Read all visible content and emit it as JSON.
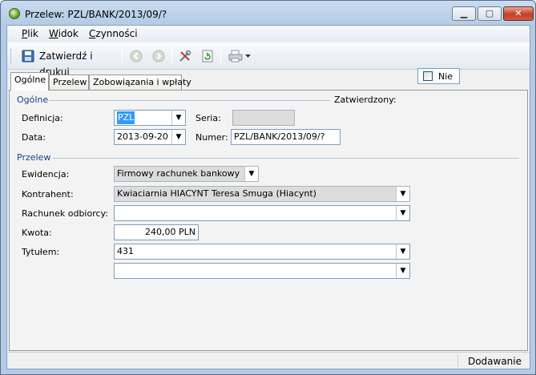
{
  "window": {
    "title": "Przelew: PZL/BANK/2013/09/?",
    "min_glyph": "▁",
    "max_glyph": "▢",
    "close_glyph": "✕"
  },
  "menu": {
    "items": [
      {
        "label": "Plik",
        "hotkey": "P",
        "rest": "lik"
      },
      {
        "label": "Widok",
        "hotkey": "W",
        "rest": "idok"
      },
      {
        "label": "Czynności",
        "hotkey": "C",
        "rest": "zynności"
      }
    ]
  },
  "toolbar": {
    "approve_print_label": "Zatwierdź i drukuj",
    "icons": [
      "save-icon",
      "back-icon",
      "forward-icon",
      "tools-icon",
      "refresh-icon",
      "print-icon",
      "dropdown-arrow-icon"
    ]
  },
  "tabs": [
    "Ogólne",
    "Przelew",
    "Zobowiązania i wpłaty"
  ],
  "general": {
    "section_label": "Ogólne",
    "approved_label": "Zatwierdzony:",
    "approved_value": "Nie",
    "definition_label": "Definicja:",
    "definition_value": "PZL",
    "series_label": "Seria:",
    "series_value": "",
    "date_label": "Data:",
    "date_value": "2013-09-20",
    "number_label": "Numer:",
    "number_value": "PZL/BANK/2013/09/?"
  },
  "transfer": {
    "section_label": "Przelew",
    "register_label": "Ewidencja:",
    "register_value": "Firmowy rachunek bankowy",
    "contractor_label": "Kontrahent:",
    "contractor_value": "Kwiaciarnia HIACYNT Teresa Smuga  (Hiacynt)",
    "recipient_account_label": "Rachunek odbiorcy:",
    "recipient_account_value": "",
    "amount_label": "Kwota:",
    "amount_value": "240,00 PLN",
    "title_label": "Tytułem:",
    "title_value": "431",
    "title2_value": ""
  },
  "status": {
    "mode": "Dodawanie"
  },
  "colors": {
    "section": "#15428b",
    "selection": "#3399ff",
    "close": "#c2402b"
  }
}
